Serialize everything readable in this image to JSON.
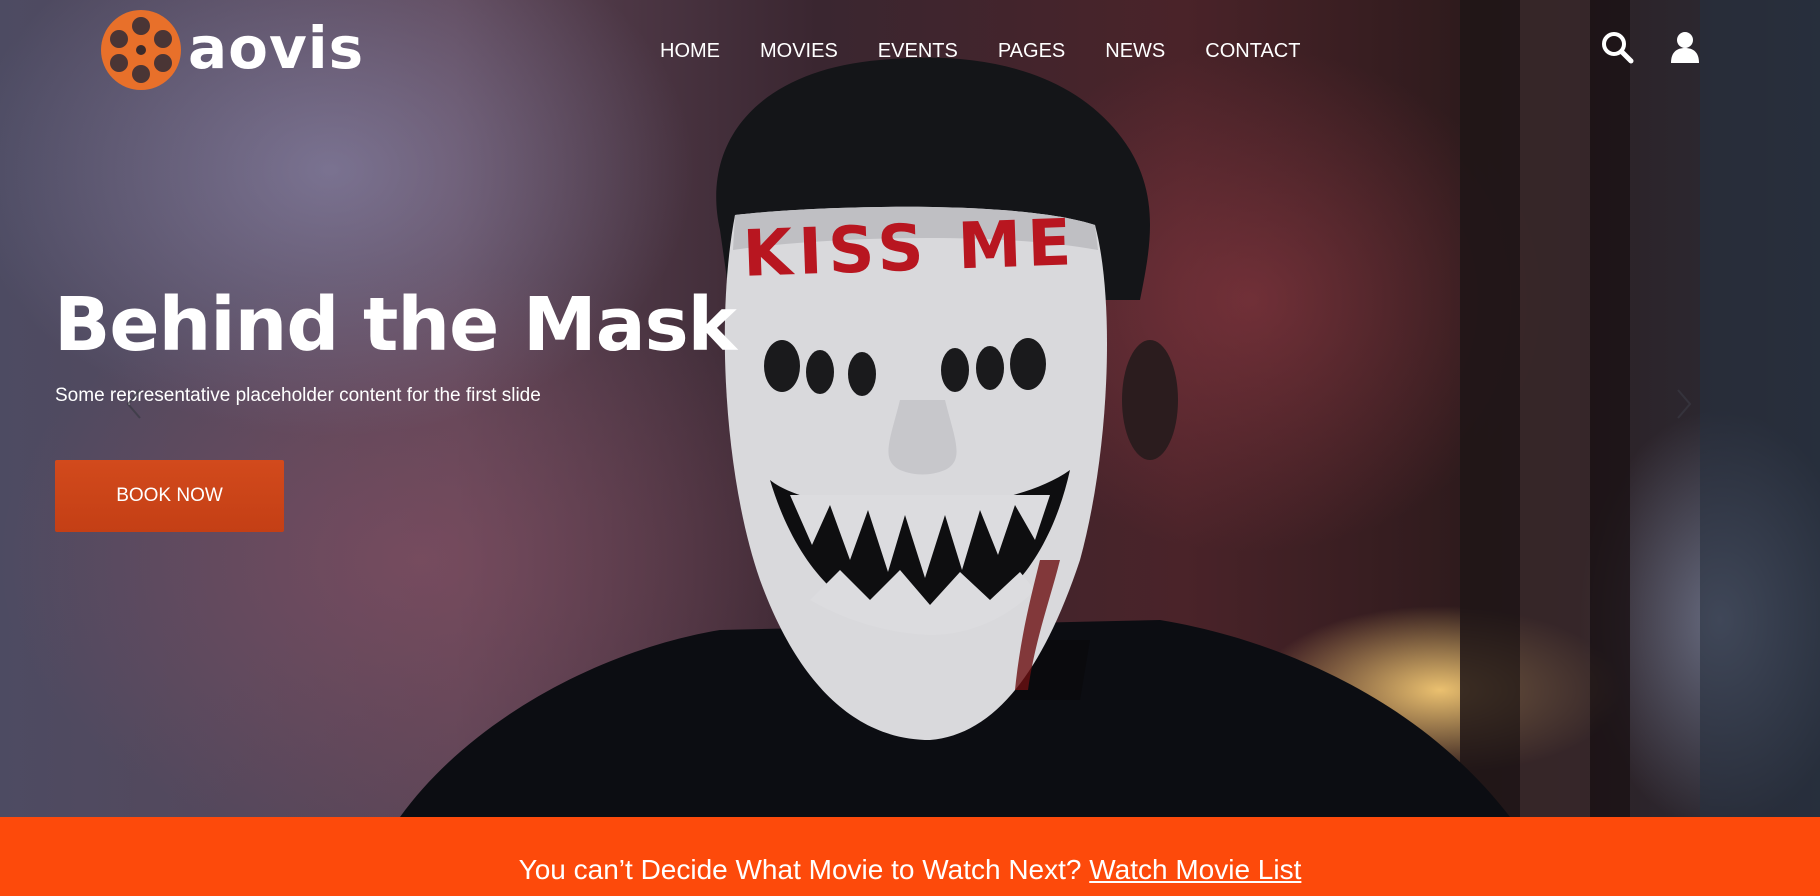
{
  "brand": {
    "name": "aovis",
    "logo_icon": "film-reel-icon",
    "accent_color": "#e8702a"
  },
  "nav": {
    "items": [
      {
        "label": "HOME"
      },
      {
        "label": "MOVIES"
      },
      {
        "label": "EVENTS"
      },
      {
        "label": "PAGES"
      },
      {
        "label": "NEWS"
      },
      {
        "label": "CONTACT"
      }
    ]
  },
  "header_icons": {
    "search": "search-icon",
    "account": "user-icon"
  },
  "slide": {
    "title": "Behind the Mask",
    "caption": "Some representative placeholder content for the first slide",
    "button_label": "BOOK NOW",
    "button_color": "#cd4519",
    "mask_text": "KISS ME",
    "prev_icon": "chevron-left-icon",
    "next_icon": "chevron-right-icon"
  },
  "banner": {
    "text": "You can’t Decide What Movie to Watch Next?",
    "link_text": "Watch Movie List",
    "background": "#fd4a0b"
  }
}
